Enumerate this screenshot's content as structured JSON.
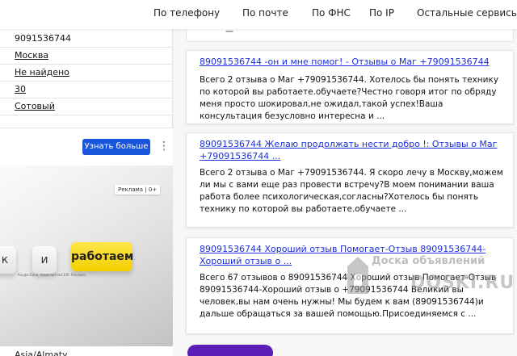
{
  "nav": {
    "items": [
      "По телефону",
      "По почте",
      "По ФНС",
      "По IP",
      "Остальные сервисы"
    ]
  },
  "info_rows": [
    {
      "value": "9091536744"
    },
    {
      "value": "Москва"
    },
    {
      "value": "Не найдено"
    },
    {
      "value": "30"
    },
    {
      "value": "Сотовый"
    }
  ],
  "ad": {
    "button_label": "Узнать больше",
    "menu_icon": "⋮",
    "badge": "Реклама | 0+",
    "keys": [
      "к",
      "и",
      "работаем"
    ],
    "fine_print": "Альфа-Банк, лицензия №1326. Реклама.",
    "bottom_text": "Asia/Almaty"
  },
  "cards": [
    {
      "title": "89091536744 -он и мне помог! - Отзывы о Маг +79091536744",
      "body": "Всего 2 отзыва о Маг +79091536744. Хотелось бы понять технику по которой вы работаете.обучаете?Честно говоря итог по обряду меня просто шокировал,не ожидал,такой успех!Ваша консультация безусловно интересна и ..."
    },
    {
      "title": "89091536744 Желаю продолжать нести добро !: Отзывы о Маг +79091536744 ...",
      "body": "Всего 2 отзыва о Маг +79091536744. Я скоро лечу в Москву,можем ли мы с вами еще раз провести встречу?В моем понимании ваша работа более психологическая,согласны?Хотелось бы понять технику по которой вы работаете.обучаете ..."
    },
    {
      "title": "89091536744 Хороший отзыв Помогает-Отзыв 89091536744-Хороший отзыв о ...",
      "body": "Всего 67 отзывов о 89091536744 Хороший отзыв Помогает-Отзыв 89091536744-Хороший отзыв о +79091536744 Великий вы человек,вы нам очень нужны! Мы будем к вам (89091536744)и дальше обращаться за вашей помощью.Присоединяемся с ..."
    }
  ],
  "watermark": {
    "text": "Доска объявлений",
    "site": "DOSKI.RU"
  },
  "colors": {
    "link": "#1b2fd9",
    "ad_button": "#1a56db",
    "key_yellow": "#f3cf00",
    "purple": "#5b1fb8"
  }
}
